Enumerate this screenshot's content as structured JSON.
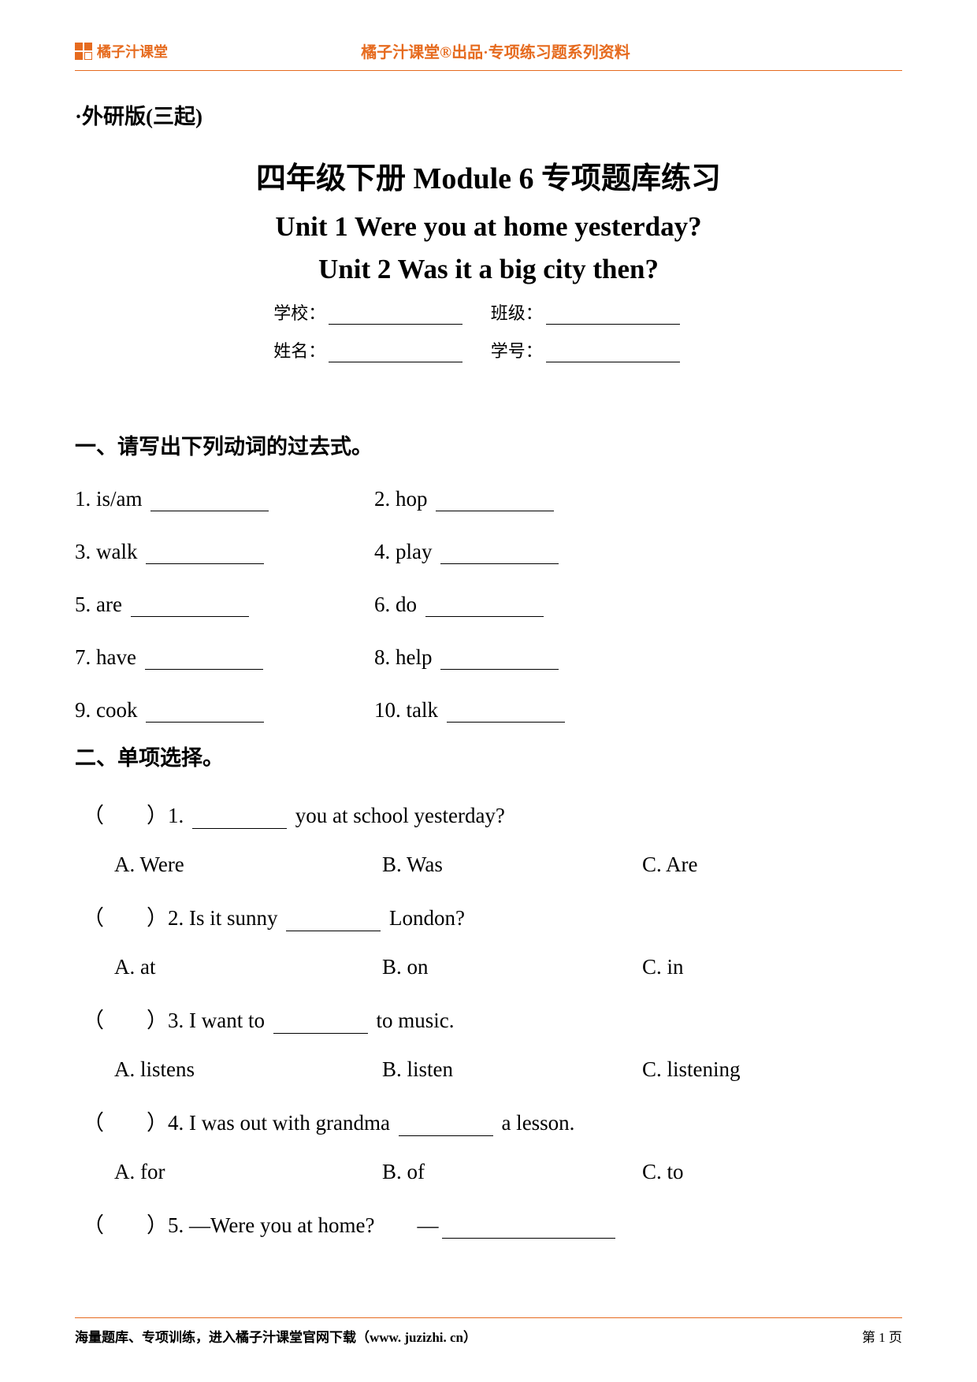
{
  "header": {
    "brand": "橘子汁课堂",
    "center": "橘子汁课堂®出品·专项练习题系列资料"
  },
  "edition": "·外研版(三起)",
  "titles": {
    "line1": "四年级下册 Module 6 专项题库练习",
    "line2": "Unit 1 Were you at home yesterday?",
    "line3": "Unit 2 Was it a big city then?"
  },
  "info": {
    "school_label": "学校：",
    "class_label": "班级：",
    "name_label": "姓名：",
    "id_label": "学号："
  },
  "section1": {
    "title": "一、请写出下列动词的过去式。",
    "items": [
      "1. is/am",
      "2. hop",
      "3. walk",
      "4. play",
      "5. are",
      "6. do",
      "7. have",
      "8. help",
      "9. cook",
      "10. talk"
    ]
  },
  "section2": {
    "title": "二、单项选择。",
    "questions": [
      {
        "stem_pre": "（　　）1. ",
        "stem_post": " you at school yesterday?",
        "blank": true,
        "opts": {
          "A": "A. Were",
          "B": "B. Was",
          "C": "C. Are"
        }
      },
      {
        "stem_pre": "（　　）2. Is it sunny ",
        "stem_post": " London?",
        "blank": true,
        "opts": {
          "A": "A. at",
          "B": "B. on",
          "C": "C. in"
        }
      },
      {
        "stem_pre": "（　　）3. I want to ",
        "stem_post": " to music.",
        "blank": true,
        "opts": {
          "A": "A. listens",
          "B": "B. listen",
          "C": "C. listening"
        }
      },
      {
        "stem_pre": "（　　）4. I was out with grandma ",
        "stem_post": " a lesson.",
        "blank": true,
        "opts": {
          "A": "A. for",
          "B": "B. of",
          "C": "C. to"
        }
      },
      {
        "stem_pre": "（　　）5. —Were you at home?　　—",
        "stem_post": "",
        "blank_long": true,
        "opts": null
      }
    ]
  },
  "footer": {
    "left": "海量题库、专项训练，进入橘子汁课堂官网下载（www. juzizhi. cn）",
    "right": "第 1 页"
  }
}
